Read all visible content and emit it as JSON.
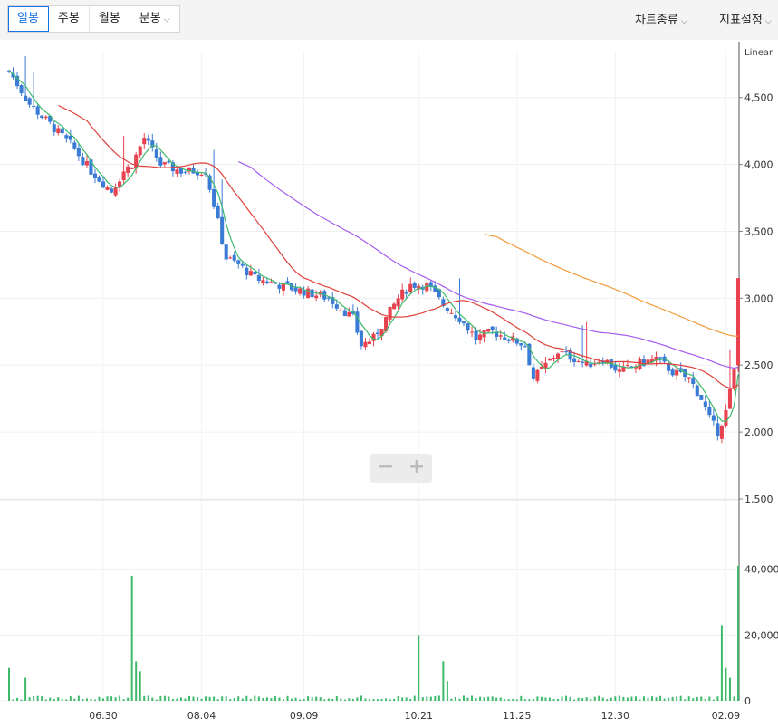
{
  "tabs": [
    {
      "label": "일봉",
      "active": true
    },
    {
      "label": "주봉",
      "active": false
    },
    {
      "label": "월봉",
      "active": false
    },
    {
      "label": "분봉",
      "active": false,
      "dropdown": true
    }
  ],
  "menus": {
    "chart_type": "차트종류",
    "indicator": "지표설정"
  },
  "scale_label": "Linear",
  "zoom": {
    "minus": "−",
    "plus": "+"
  },
  "colors": {
    "up": "#e8424f",
    "down": "#3a7bd5",
    "ma5": "#3dba6b",
    "ma20": "#e0403a",
    "ma60": "#a45cf0",
    "ma120": "#f09b3a",
    "volume": "#3dba6b"
  },
  "chart_data": {
    "type": "candlestick",
    "scale": "linear",
    "y_ticks": [
      "4,500",
      "4,000",
      "3,500",
      "3,000",
      "2,500",
      "2,000",
      "1,500"
    ],
    "y_tick_values": [
      4500,
      4000,
      3500,
      3000,
      2500,
      2000,
      1500
    ],
    "ylim": [
      1500,
      4850
    ],
    "volume_ticks": [
      "40,000,0",
      "20,000,0",
      "0"
    ],
    "volume_tick_values": [
      40000000,
      20000000,
      0
    ],
    "volume_lim": [
      0,
      60000000
    ],
    "x_tick_labels": [
      {
        "label": "06.30",
        "idx": 23
      },
      {
        "label": "08.04",
        "idx": 47
      },
      {
        "label": "09.09",
        "idx": 72
      },
      {
        "label": "10.21",
        "idx": 100
      },
      {
        "label": "11.25",
        "idx": 124
      },
      {
        "label": "12.30",
        "idx": 148
      },
      {
        "label": "02.09",
        "idx": 175
      }
    ],
    "candle_count": 179,
    "price_path": [
      [
        0,
        4700
      ],
      [
        5,
        4450
      ],
      [
        10,
        4300
      ],
      [
        15,
        4150
      ],
      [
        20,
        3950
      ],
      [
        25,
        3800
      ],
      [
        28,
        3950
      ],
      [
        30,
        4000
      ],
      [
        33,
        4200
      ],
      [
        37,
        4000
      ],
      [
        42,
        3950
      ],
      [
        48,
        3950
      ],
      [
        50,
        3700
      ],
      [
        53,
        3300
      ],
      [
        56,
        3250
      ],
      [
        60,
        3150
      ],
      [
        66,
        3100
      ],
      [
        72,
        3050
      ],
      [
        78,
        3000
      ],
      [
        84,
        2850
      ],
      [
        86,
        2650
      ],
      [
        89,
        2700
      ],
      [
        92,
        2850
      ],
      [
        95,
        3000
      ],
      [
        98,
        3100
      ],
      [
        102,
        3100
      ],
      [
        106,
        2950
      ],
      [
        110,
        2850
      ],
      [
        114,
        2700
      ],
      [
        118,
        2750
      ],
      [
        122,
        2700
      ],
      [
        126,
        2650
      ],
      [
        128,
        2400
      ],
      [
        131,
        2500
      ],
      [
        134,
        2600
      ],
      [
        138,
        2550
      ],
      [
        141,
        2500
      ],
      [
        145,
        2550
      ],
      [
        149,
        2450
      ],
      [
        153,
        2500
      ],
      [
        158,
        2550
      ],
      [
        162,
        2450
      ],
      [
        166,
        2400
      ],
      [
        169,
        2250
      ],
      [
        171,
        2100
      ],
      [
        173,
        2000
      ],
      [
        175,
        2150
      ],
      [
        177,
        2450
      ],
      [
        179,
        2550
      ]
    ],
    "last_candle": {
      "open": 2500,
      "high": 3150,
      "low": 2450,
      "close": 3150
    },
    "ma_lines": [
      {
        "key": "ma5",
        "start": 0
      },
      {
        "key": "ma20",
        "start": 12
      },
      {
        "key": "ma60",
        "start": 56
      },
      {
        "key": "ma120",
        "start": 116
      }
    ],
    "volume_spikes": {
      "0": 10000000,
      "4": 7000000,
      "30": 38000000,
      "31": 12000000,
      "32": 9000000,
      "100": 20000000,
      "106": 12000000,
      "107": 6000000,
      "174": 23000000,
      "175": 10000000,
      "176": 7000000,
      "178": 41000000
    },
    "volume_base": 1200000
  }
}
